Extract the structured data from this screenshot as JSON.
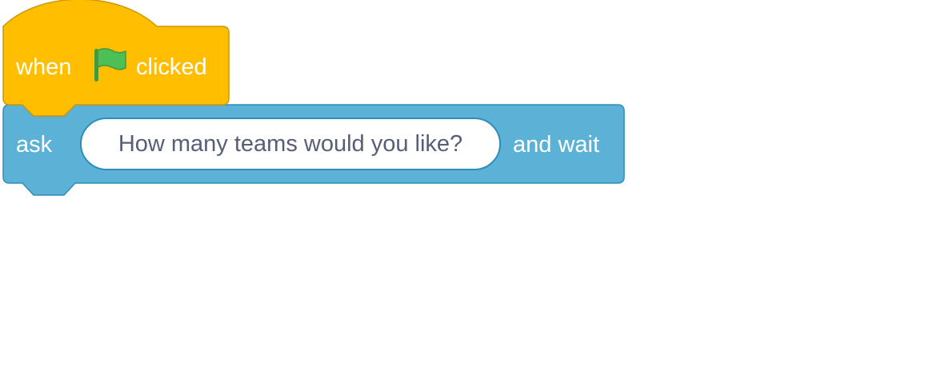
{
  "hat_block": {
    "label_before": "when",
    "icon": "green-flag-icon",
    "label_after": "clicked",
    "fill_color": "#FFBF00",
    "stroke_color": "#CC9900"
  },
  "ask_block": {
    "label_before": "ask",
    "input_value": "How many teams would you like?",
    "label_after": "and wait",
    "fill_color": "#5CB1D6",
    "stroke_color": "#2E8EB8"
  },
  "flag_color": "#4CBF56",
  "flag_stroke": "#45993D"
}
